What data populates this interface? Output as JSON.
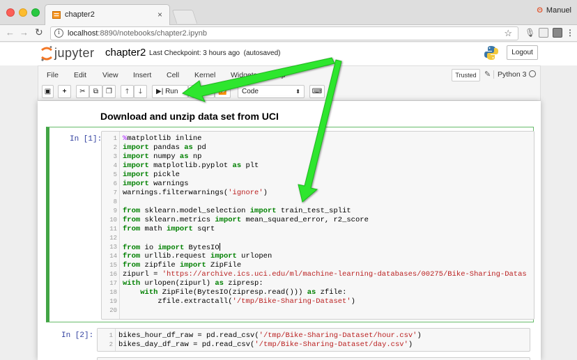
{
  "browser": {
    "tab_title": "chapter2",
    "tab_close": "×",
    "profile_name": "Manuel",
    "url_host": "localhost",
    "url_rest": ":8890/notebooks/chapter2.ipynb"
  },
  "jupyter": {
    "logo_text": "jupyter",
    "notebook_name": "chapter2",
    "checkpoint": "Last Checkpoint: 3 hours ago",
    "autosave": "(autosaved)",
    "logout_label": "Logout",
    "trusted_label": "Trusted",
    "kernel_name": "Python 3"
  },
  "menu": {
    "file": "File",
    "edit": "Edit",
    "view": "View",
    "insert": "Insert",
    "cell": "Cell",
    "kernel": "Kernel",
    "widgets": "Widgets",
    "help": "Help"
  },
  "toolbar": {
    "run_label": "Run",
    "cell_type": "Code"
  },
  "cells": {
    "heading": "Download and unzip data set from UCI",
    "prompt1": "In [1]:",
    "prompt2": "In [2]:"
  },
  "colors": {
    "arrow": "#2ee62e",
    "selected_cell": "#42a545",
    "keyword": "#008000",
    "string": "#ba2121"
  },
  "code1": [
    [
      [
        "mg",
        "%"
      ],
      [
        "",
        "matplotlib inline"
      ]
    ],
    [
      [
        "kw",
        "import"
      ],
      [
        "",
        " pandas "
      ],
      [
        "kw",
        "as"
      ],
      [
        "",
        " pd"
      ]
    ],
    [
      [
        "kw",
        "import"
      ],
      [
        "",
        " numpy "
      ],
      [
        "kw",
        "as"
      ],
      [
        "",
        " np"
      ]
    ],
    [
      [
        "kw",
        "import"
      ],
      [
        "",
        " matplotlib.pyplot "
      ],
      [
        "kw",
        "as"
      ],
      [
        "",
        " plt"
      ]
    ],
    [
      [
        "kw",
        "import"
      ],
      [
        "",
        " pickle"
      ]
    ],
    [
      [
        "kw",
        "import"
      ],
      [
        "",
        " warnings"
      ]
    ],
    [
      [
        "",
        "warnings.filterwarnings("
      ],
      [
        "st",
        "'ignore'"
      ],
      [
        "",
        ")"
      ]
    ],
    [],
    [
      [
        "kw",
        "from"
      ],
      [
        "",
        " sklearn.model_selection "
      ],
      [
        "kw",
        "import"
      ],
      [
        "",
        " train_test_split"
      ]
    ],
    [
      [
        "kw",
        "from"
      ],
      [
        "",
        " sklearn.metrics "
      ],
      [
        "kw",
        "import"
      ],
      [
        "",
        " mean_squared_error, r2_score"
      ]
    ],
    [
      [
        "kw",
        "from"
      ],
      [
        "",
        " math "
      ],
      [
        "kw",
        "import"
      ],
      [
        "",
        " sqrt"
      ]
    ],
    [],
    [
      [
        "kw",
        "from"
      ],
      [
        "",
        " io "
      ],
      [
        "kw",
        "import"
      ],
      [
        "",
        " BytesIO"
      ],
      [
        "cursor",
        ""
      ]
    ],
    [
      [
        "kw",
        "from"
      ],
      [
        "",
        " urllib.request "
      ],
      [
        "kw",
        "import"
      ],
      [
        "",
        " urlopen"
      ]
    ],
    [
      [
        "kw",
        "from"
      ],
      [
        "",
        " zipfile "
      ],
      [
        "kw",
        "import"
      ],
      [
        "",
        " ZipFile"
      ]
    ],
    [
      [
        "",
        "zipurl = "
      ],
      [
        "st",
        "'https://archive.ics.uci.edu/ml/machine-learning-databases/00275/Bike-Sharing-Datas"
      ]
    ],
    [
      [
        "kw",
        "with"
      ],
      [
        "",
        " urlopen(zipurl) "
      ],
      [
        "kw",
        "as"
      ],
      [
        "",
        " zipresp:"
      ]
    ],
    [
      [
        "",
        "    "
      ],
      [
        "kw",
        "with"
      ],
      [
        "",
        " ZipFile(BytesIO(zipresp.read())) "
      ],
      [
        "kw",
        "as"
      ],
      [
        "",
        " zfile:"
      ]
    ],
    [
      [
        "",
        "        zfile.extractall("
      ],
      [
        "st",
        "'/tmp/Bike-Sharing-Dataset'"
      ],
      [
        "",
        ")"
      ]
    ],
    []
  ],
  "code2": [
    [
      [
        "",
        "bikes_hour_df_raw = pd.read_csv("
      ],
      [
        "st",
        "'/tmp/Bike-Sharing-Dataset/hour.csv'"
      ],
      [
        "",
        ")"
      ]
    ],
    [
      [
        "",
        "bikes_day_df_raw = pd.read_csv("
      ],
      [
        "st",
        "'/tmp/Bike-Sharing-Dataset/day.csv'"
      ],
      [
        "",
        ")"
      ]
    ]
  ]
}
